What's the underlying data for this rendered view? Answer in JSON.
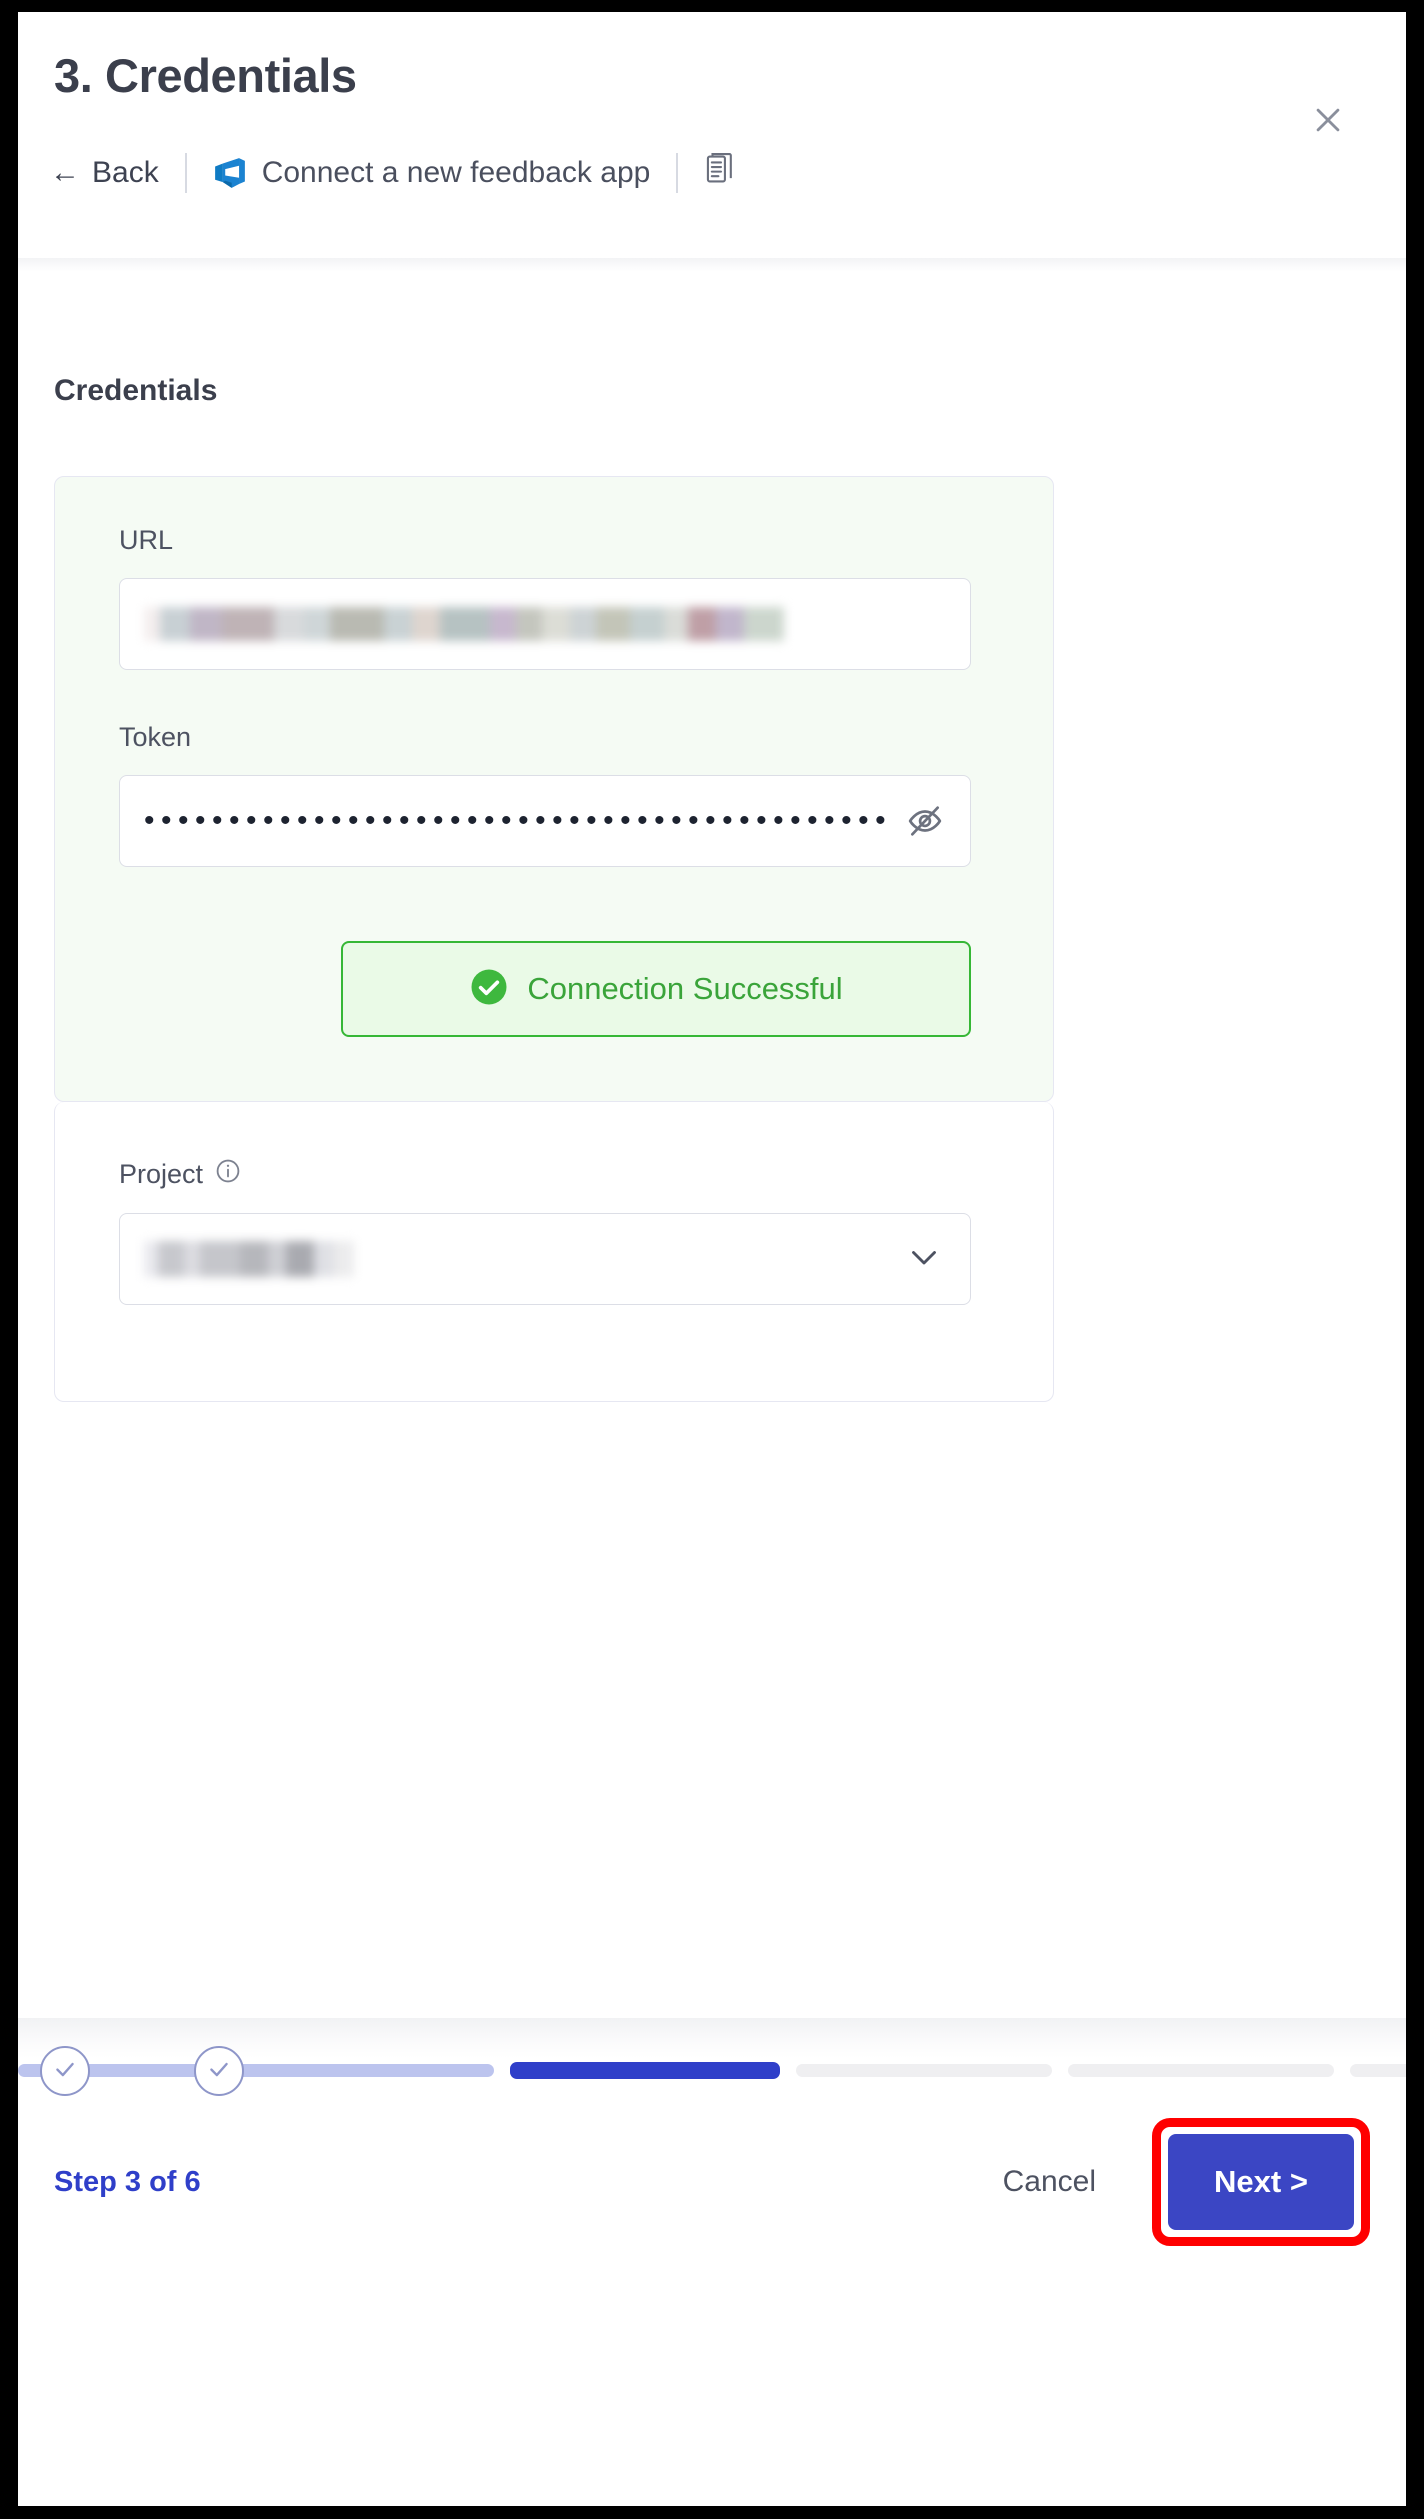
{
  "header": {
    "title": "3. Credentials",
    "back_label": "Back",
    "back_arrow": "←",
    "app_label": "Connect a new feedback app",
    "app_icon": "azure-devops-icon",
    "doc_icon": "document-icon",
    "close_icon": "close-icon"
  },
  "main": {
    "section_title": "Credentials",
    "url_field": {
      "label": "URL",
      "value": "",
      "redacted": true
    },
    "token_field": {
      "label": "Token",
      "value": "••••••••••••••••••••••••••••••••••••••••••••",
      "toggle_icon": "eye-off-icon"
    },
    "connection_button": {
      "label": "Connection Successful",
      "icon": "check-circle-icon",
      "color": "#3aa43a",
      "border_color": "#36b736",
      "background": "#eafae7"
    },
    "project_field": {
      "label": "Project",
      "info_icon": "info-icon",
      "value": "",
      "redacted": true,
      "chevron_icon": "chevron-down-icon"
    }
  },
  "footer": {
    "step_text": "Step 3 of 6",
    "cancel_label": "Cancel",
    "next_label": "Next >",
    "accent_color": "#2f3fc9",
    "highlight_color": "#ff0000",
    "stepper": {
      "total": 6,
      "current": 3,
      "segments": [
        {
          "state": "done"
        },
        {
          "state": "done"
        },
        {
          "state": "active"
        },
        {
          "state": "todo"
        },
        {
          "state": "todo"
        },
        {
          "state": "todo"
        }
      ]
    }
  }
}
